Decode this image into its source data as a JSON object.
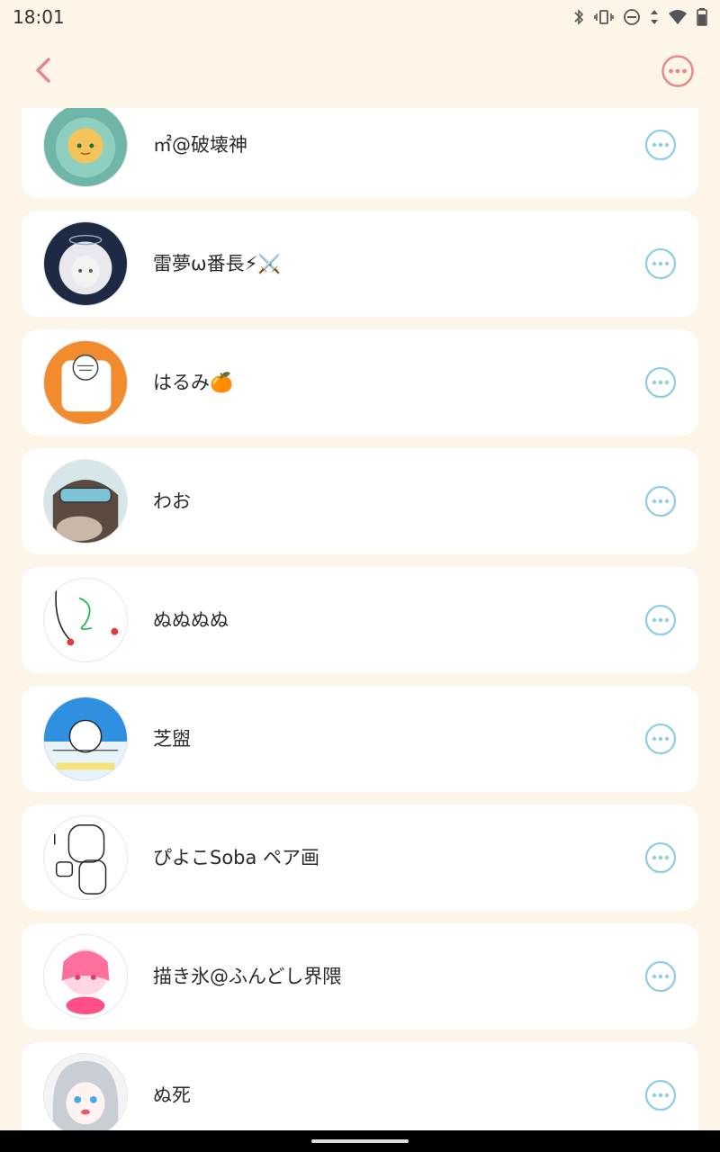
{
  "status_bar": {
    "time": "18:01",
    "icons": [
      "bluetooth-icon",
      "vibrate-icon",
      "do-not-disturb-icon",
      "data-arrows-icon",
      "wifi-icon",
      "battery-icon"
    ]
  },
  "header": {
    "back_icon": "chevron-left-icon",
    "more_icon": "more-horizontal-icon",
    "accent_color": "#e8868d"
  },
  "list": {
    "more_icon_color": "#8ecde6",
    "items": [
      {
        "name": "㎡@破壊神",
        "avatar": "teal-fluffy-character"
      },
      {
        "name": "雷夢ω番長⚡⚔️",
        "avatar": "white-hair-anime-girl"
      },
      {
        "name": "はるみ🍊",
        "avatar": "orange-doodle"
      },
      {
        "name": "わお",
        "avatar": "goggles-character"
      },
      {
        "name": "ぬぬぬぬ",
        "avatar": "scribble-nu"
      },
      {
        "name": "芝盥",
        "avatar": "snowman-sky"
      },
      {
        "name": "ぴよこSoba ペア画",
        "avatar": "handwritten-piyo"
      },
      {
        "name": "描き氷@ふんどし界隈",
        "avatar": "pink-anime-girl"
      },
      {
        "name": "ぬ死",
        "avatar": "grey-hair-anime-girl"
      }
    ]
  }
}
